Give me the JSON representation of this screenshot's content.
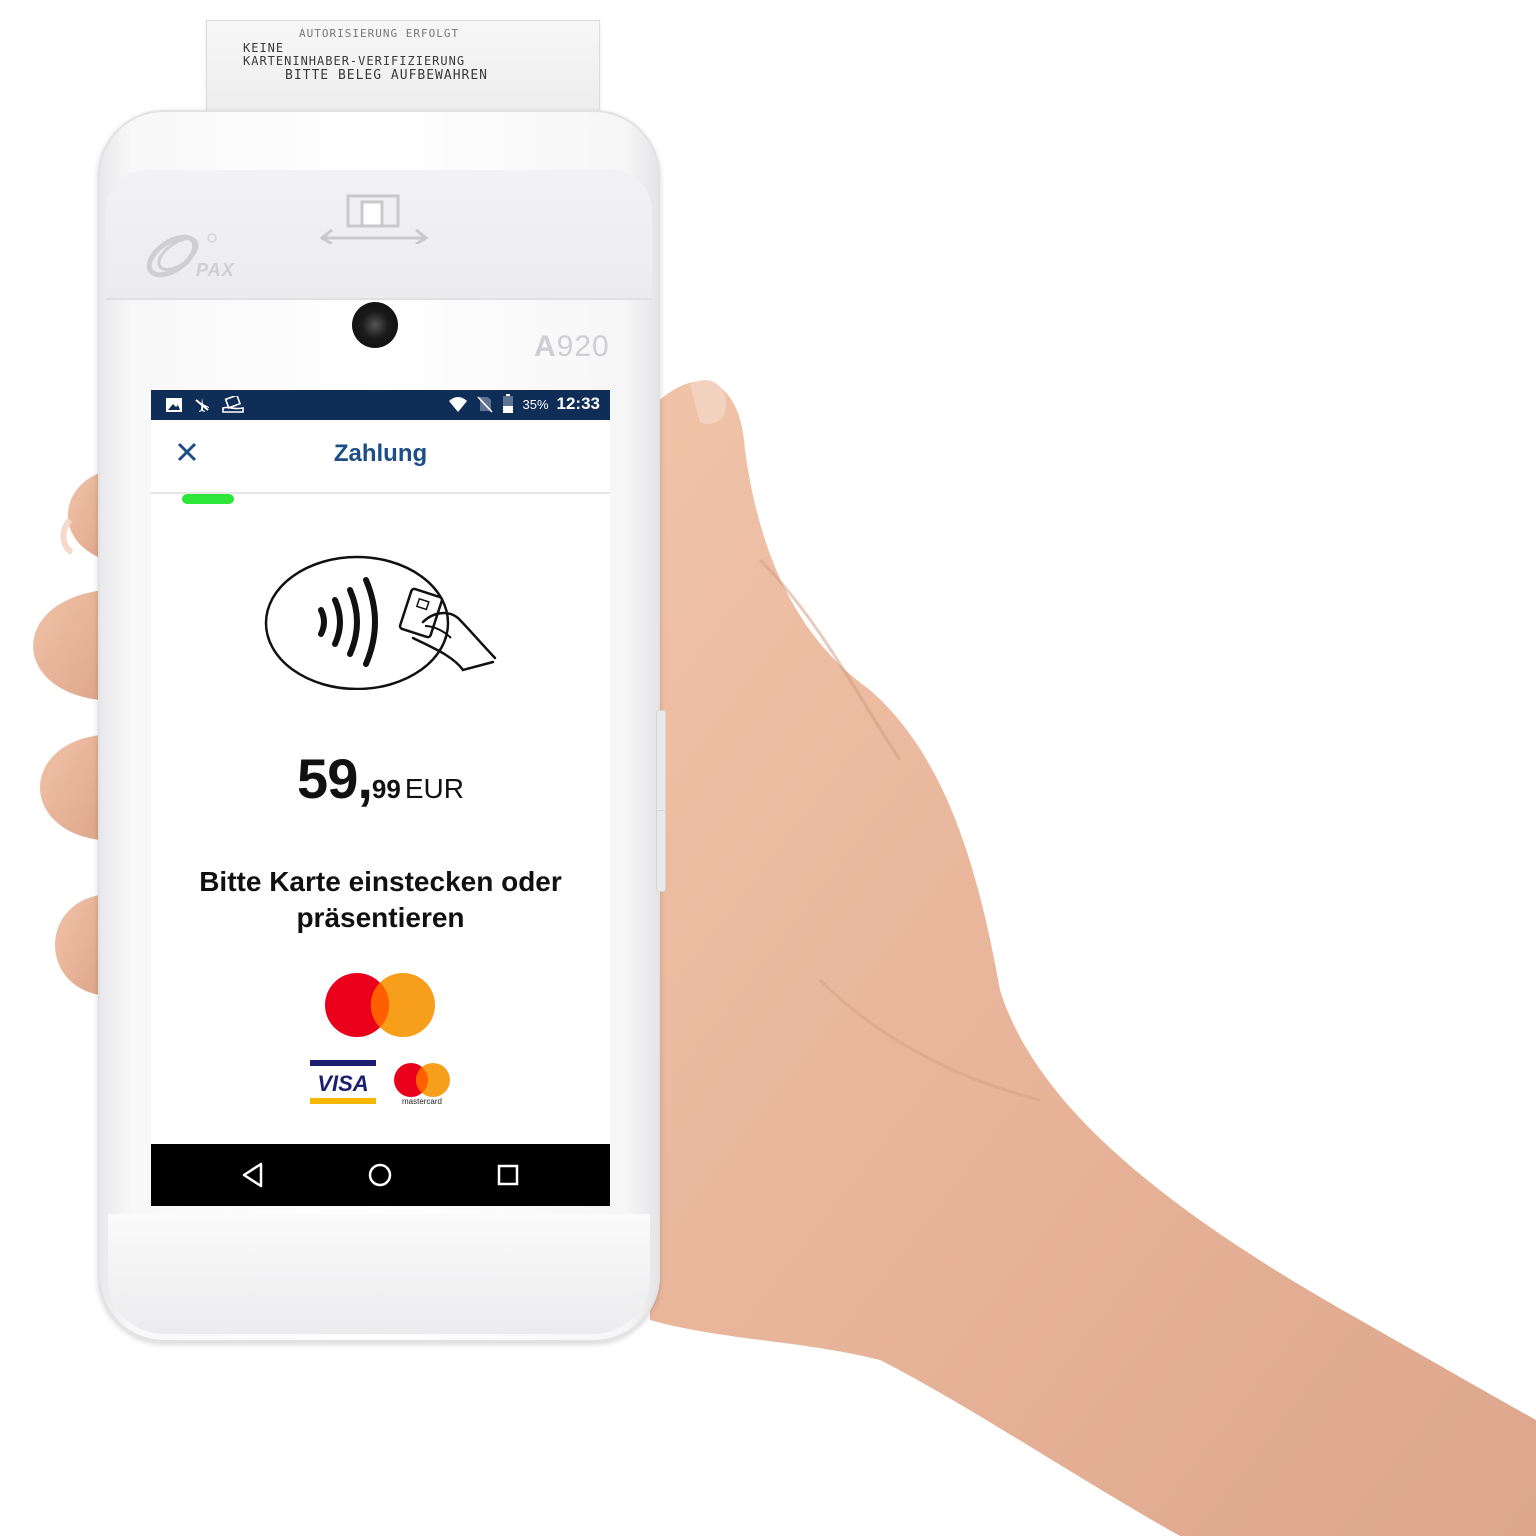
{
  "receipt": {
    "line0": "AUTORISIERUNG ERFOLGT",
    "line1": "KEINE",
    "line2": "KARTENINHABER-VERIFIZIERUNG",
    "line3": "BITTE BELEG AUFBEWAHREN"
  },
  "device": {
    "brand": "PAX",
    "model_prefix": "A",
    "model_number": "920"
  },
  "statusbar": {
    "icons_left": [
      "image-icon",
      "airplane-off-icon",
      "hand-card-icon"
    ],
    "icons_right": [
      "wifi-icon",
      "no-sim-icon",
      "battery-icon"
    ],
    "battery": "35%",
    "time": "12:33"
  },
  "appbar": {
    "close_icon": "close-icon",
    "title": "Zahlung"
  },
  "payment": {
    "amount_main": "59,",
    "amount_cents": "99",
    "currency": "EUR",
    "prompt": "Bitte Karte einstecken oder präsentieren",
    "progress": 0.11
  },
  "brands": {
    "visa_label": "VISA",
    "mastercard_label": "mastercard"
  },
  "colors": {
    "statusbar": "#0f2e57",
    "title": "#1d4e86",
    "progress": "#2ee63a",
    "mc_red": "#eb001b",
    "mc_orange": "#f79e1b",
    "mc_overlap": "#ff5f00",
    "visa_blue": "#1a1f71",
    "visa_gold": "#f7b600"
  },
  "navbar": {
    "buttons": [
      "back-icon",
      "home-icon",
      "recents-icon"
    ]
  }
}
